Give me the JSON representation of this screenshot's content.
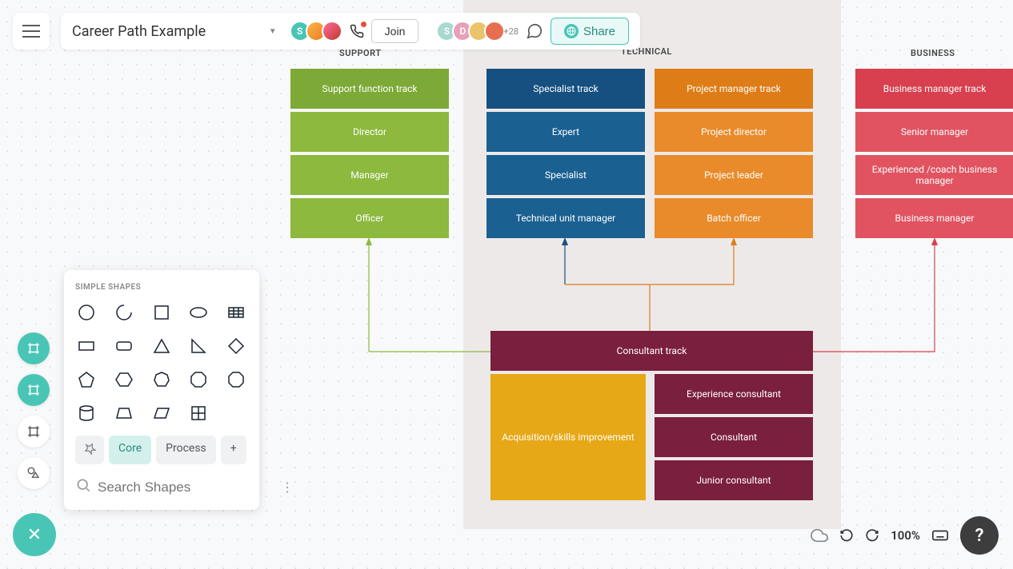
{
  "toolbar": {
    "title": "Career Path Example",
    "join_label": "Join",
    "share_label": "Share",
    "plus_count": "+28",
    "avatar_initial_1": "S",
    "avatar_initial_2": "S",
    "avatar_initial_3": "D"
  },
  "shapes_panel": {
    "header": "SIMPLE SHAPES",
    "tabs": {
      "core": "Core",
      "process": "Process"
    },
    "search_placeholder": "Search Shapes"
  },
  "diagram": {
    "columns": {
      "support": {
        "label": "SUPPORT",
        "blocks": [
          "Support   function   track",
          "Director",
          "Manager",
          "Officer"
        ]
      },
      "technical": {
        "label": "TECHNICAL",
        "spec": [
          "Specialist    track",
          "Expert",
          "Specialist",
          "Technical    unit   manager"
        ],
        "proj": [
          "Project   manager    track",
          "Project    director",
          "Project    leader",
          "Batch    officer"
        ]
      },
      "business": {
        "label": "BUSINESS",
        "blocks": [
          "Business   manager    track",
          "Senior   manager",
          "Experienced    /coach   business manager",
          "Business   manager"
        ]
      },
      "consultant": {
        "track": "Consultant    track",
        "acq": "Acquisition/skills improvement",
        "levels": [
          "Experience    consultant",
          "Consultant",
          "Junior   consultant"
        ]
      }
    }
  },
  "footer": {
    "zoom": "100%"
  }
}
